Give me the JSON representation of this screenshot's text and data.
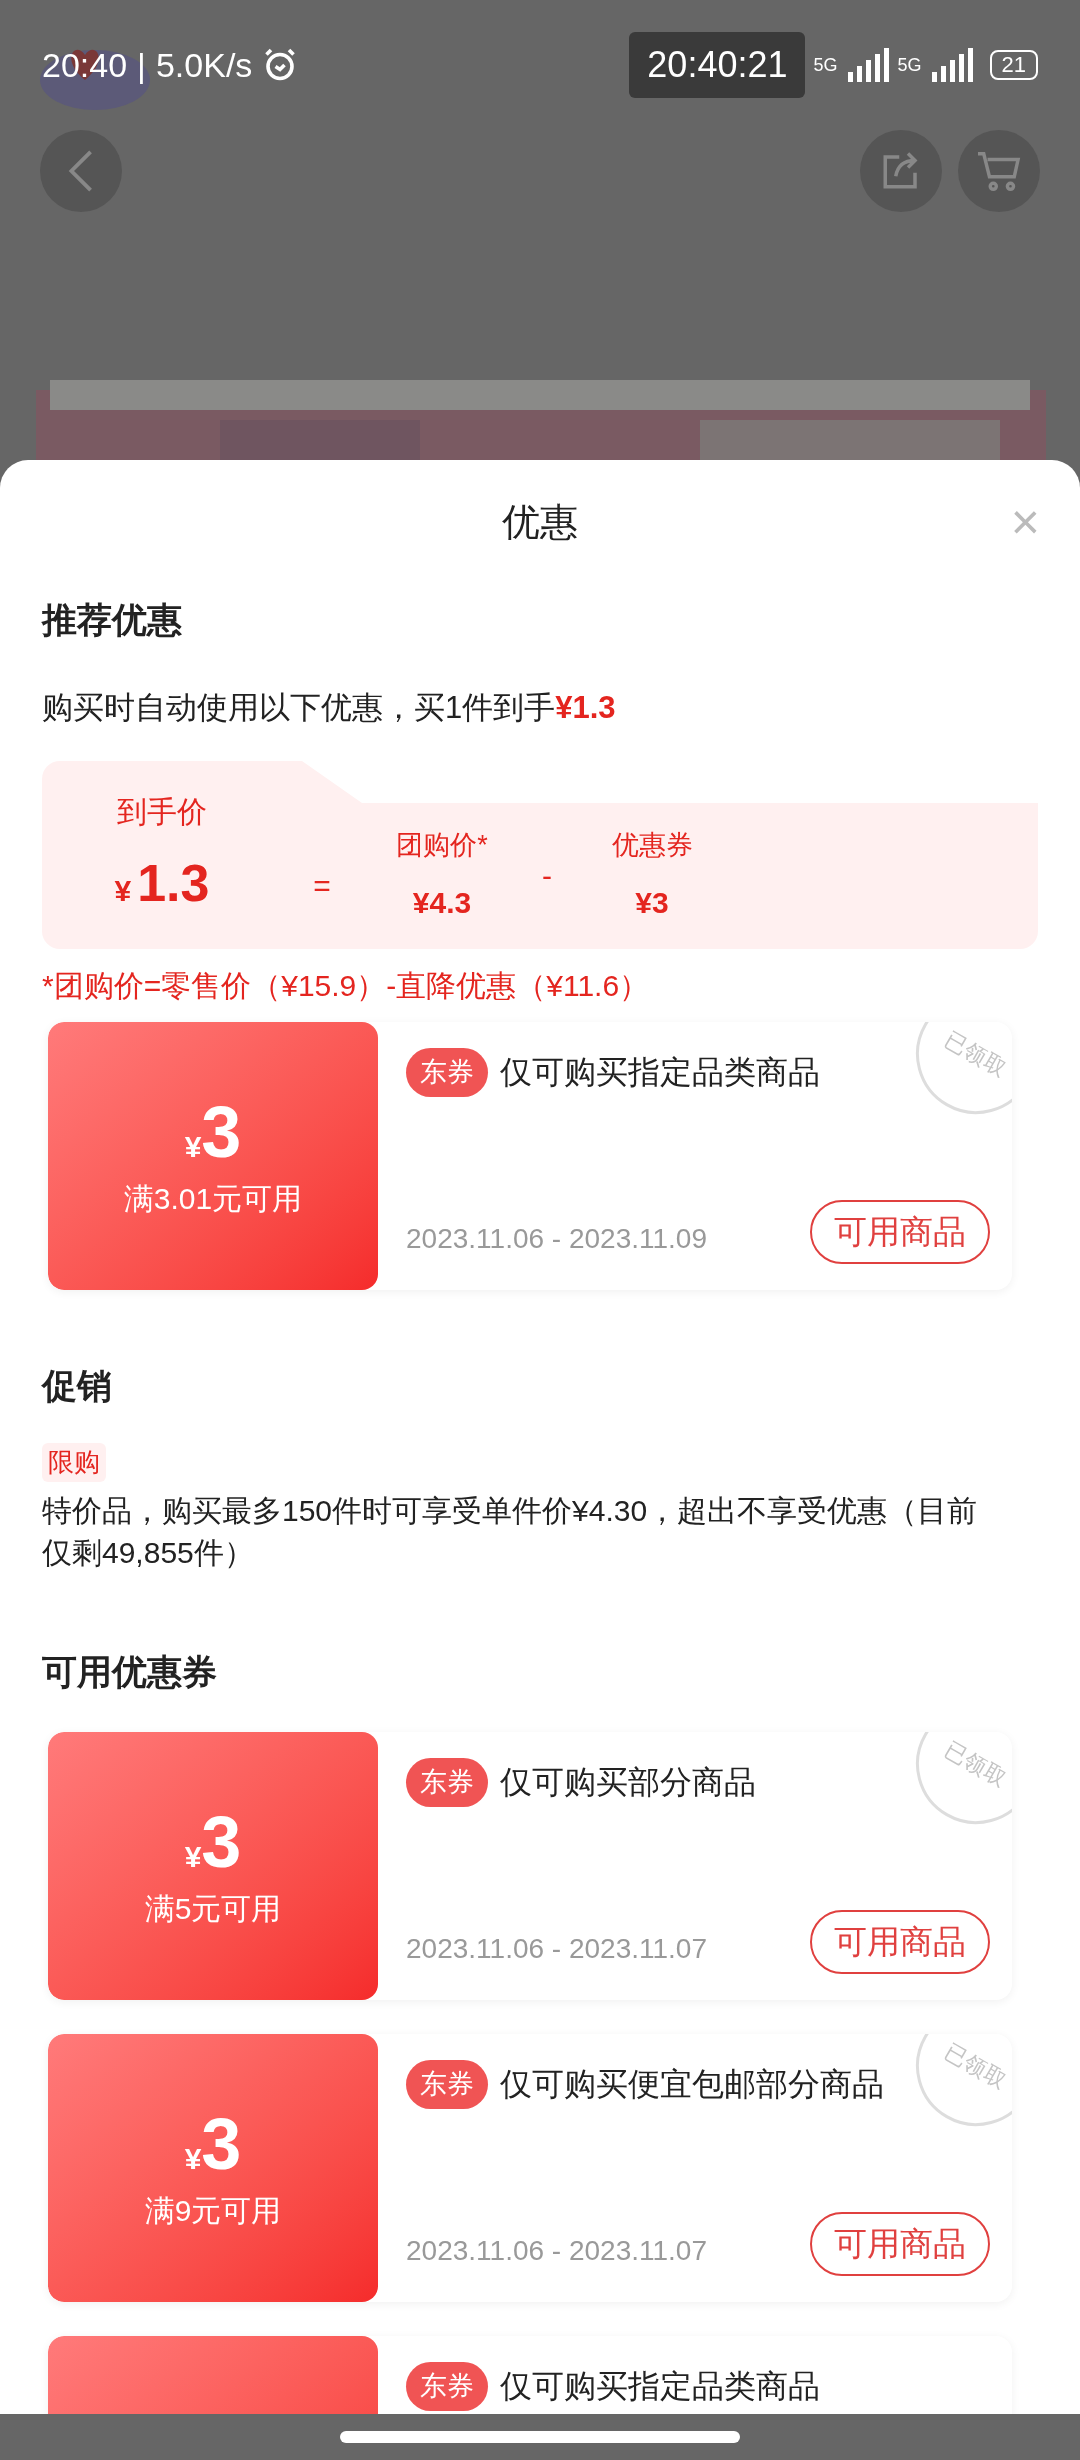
{
  "status_bar": {
    "time": "20:40",
    "separator": "|",
    "speed": "5.0K/s",
    "clock_overlay": "20:40:21",
    "network_1": "5G",
    "network_2": "5G",
    "battery": "21"
  },
  "sheet": {
    "title": "优惠",
    "close": "×"
  },
  "recommended": {
    "heading": "推荐优惠",
    "summary": "购买时自动使用以下优惠，买1件到手",
    "summary_price": "¥1.3",
    "final_label": "到手价",
    "final_currency": "¥",
    "final_amount": "1.3",
    "equals": "=",
    "group_label": "团购价*",
    "group_price": "¥4.3",
    "minus": "-",
    "coupon_label": "优惠券",
    "coupon_price": "¥3",
    "footnote": "*团购价=零售价（¥15.9）-直降优惠（¥11.6）"
  },
  "applied_coupons": [
    {
      "tag": "东券",
      "description": "仅可购买指定品类商品",
      "currency": "¥",
      "amount": "3",
      "condition": "满3.01元可用",
      "dates": "2023.11.06 - 2023.11.09",
      "button": "可用商品",
      "stamp": "已领取"
    }
  ],
  "promotion": {
    "heading": "促销",
    "tag": "限购",
    "text": "特价品，购买最多150件时可享受单件价¥4.30，超出不享受优惠（目前仅剩49,855件）"
  },
  "available": {
    "heading": "可用优惠券",
    "coupons": [
      {
        "tag": "东券",
        "description": "仅可购买部分商品",
        "currency": "¥",
        "amount": "3",
        "condition": "满5元可用",
        "dates": "2023.11.06 - 2023.11.07",
        "button": "可用商品",
        "stamp": "已领取"
      },
      {
        "tag": "东券",
        "description": "仅可购买便宜包邮部分商品",
        "currency": "¥",
        "amount": "3",
        "condition": "满9元可用",
        "dates": "2023.11.06 - 2023.11.07",
        "button": "可用商品",
        "stamp": "已领取"
      },
      {
        "tag": "东券",
        "description": "仅可购买指定品类商品"
      }
    ]
  }
}
